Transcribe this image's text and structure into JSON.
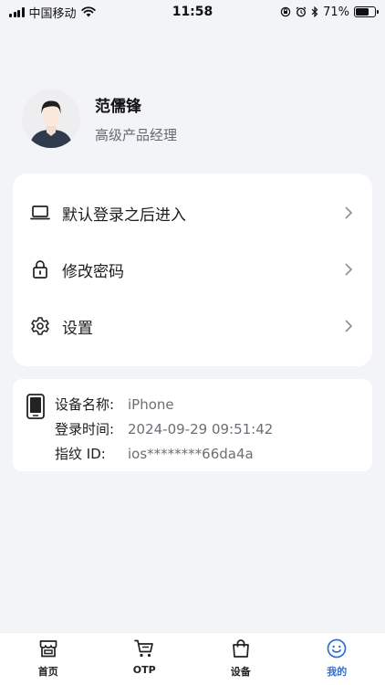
{
  "status_bar": {
    "carrier": "中国移动",
    "time": "11:58",
    "battery_percent": "71%",
    "battery_level": 0.71
  },
  "profile": {
    "name": "范儒锋",
    "title": "高级产品经理"
  },
  "menu": {
    "items": [
      {
        "label": "默认登录之后进入",
        "icon": "laptop-icon"
      },
      {
        "label": "修改密码",
        "icon": "lock-icon"
      },
      {
        "label": "设置",
        "icon": "gear-icon"
      }
    ]
  },
  "device": {
    "rows": [
      {
        "key": "设备名称:",
        "value": "iPhone"
      },
      {
        "key": "登录时间:",
        "value": "2024-09-29 09:51:42"
      },
      {
        "key": "指纹 ID:",
        "value": "ios********66da4a"
      }
    ]
  },
  "tab_bar": {
    "tabs": [
      {
        "label": "首页",
        "icon": "store-icon"
      },
      {
        "label": "OTP",
        "icon": "cart-icon"
      },
      {
        "label": "设备",
        "icon": "bag-icon"
      },
      {
        "label": "我的",
        "icon": "smile-icon",
        "active": true
      }
    ],
    "active_color": "#2f6fd6"
  }
}
